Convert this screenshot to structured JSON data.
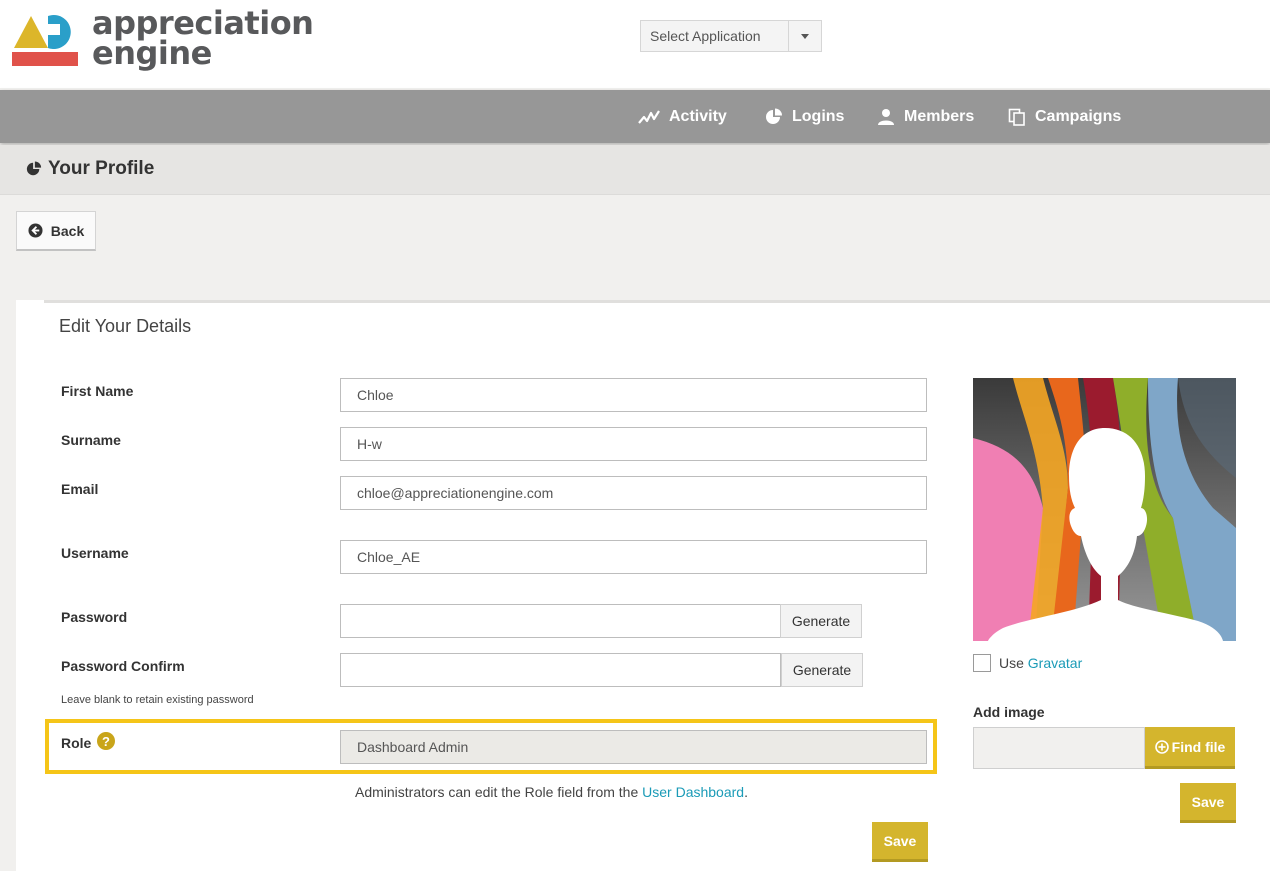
{
  "header": {
    "logo_text_line1": "appreciation",
    "logo_text_line2": "engine",
    "app_select": {
      "value": "Select Application"
    }
  },
  "nav": {
    "items": [
      {
        "label": "Activity",
        "icon": "activity-icon"
      },
      {
        "label": "Logins",
        "icon": "pie-chart-icon"
      },
      {
        "label": "Members",
        "icon": "user-icon"
      },
      {
        "label": "Campaigns",
        "icon": "copy-icon"
      }
    ]
  },
  "page": {
    "title": "Your Profile",
    "back_label": "Back"
  },
  "form": {
    "section_title": "Edit Your Details",
    "first_name": {
      "label": "First Name",
      "value": "Chloe"
    },
    "surname": {
      "label": "Surname",
      "value": "H-w"
    },
    "email": {
      "label": "Email",
      "value": "chloe@appreciationengine.com"
    },
    "username": {
      "label": "Username",
      "value": "Chloe_AE"
    },
    "password": {
      "label": "Password",
      "value": "",
      "generate_label": "Generate"
    },
    "password_confirm": {
      "label": "Password Confirm",
      "value": "",
      "generate_label": "Generate"
    },
    "password_hint": "Leave blank to retain existing password",
    "role": {
      "label": "Role",
      "value": "Dashboard Admin",
      "help": "?"
    },
    "admin_note": "Administrators can edit the Role field from the ",
    "admin_note_link": "User Dashboard",
    "admin_note_end": ".",
    "save_label": "Save"
  },
  "sidebar": {
    "use_label": "Use ",
    "gravatar_link": "Gravatar",
    "add_image_label": "Add image",
    "find_file_label": "Find file",
    "save_label": "Save"
  },
  "colors": {
    "accent": "#d4b52d",
    "highlight": "#f5c518",
    "nav_bg": "#979797",
    "link": "#1b9bb7"
  }
}
